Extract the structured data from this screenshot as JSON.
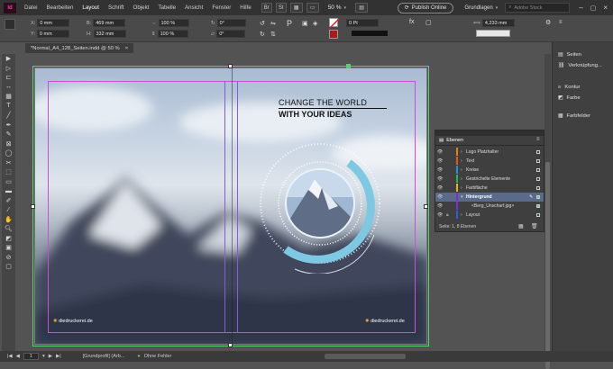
{
  "app": {
    "logo": "Id"
  },
  "menu": [
    "Datei",
    "Bearbeiten",
    "Layout",
    "Schrift",
    "Objekt",
    "Tabelle",
    "Ansicht",
    "Fenster",
    "Hilfe"
  ],
  "menubar": {
    "zoom": "50 %",
    "publish_label": "Publish Online",
    "workspace": "Grundlagen",
    "search_placeholder": "Adobe Stock"
  },
  "control": {
    "x_label": "X:",
    "x": "0 mm",
    "y_label": "Y:",
    "y": "0 mm",
    "b_label": "B:",
    "b": "469 mm",
    "h_label": "H:",
    "h": "332 mm",
    "scale_x": "100 %",
    "scale_y": "100 %",
    "angle": "0°",
    "shear": "0°",
    "stroke_weight": "0 Pt",
    "size_value": "4,233 mm",
    "opacity": "100 %"
  },
  "tab": {
    "title": "*Normal_A4_128_Seiten.indd @ 50 %",
    "close": "×"
  },
  "page": {
    "headline1": "CHANGE THE WORLD",
    "headline2": "WITH YOUR IDEAS",
    "logo_left": "diedruckerei.de",
    "logo_right": "diedruckerei.de"
  },
  "layers": {
    "title": "Ebenen",
    "rows": [
      {
        "name": "Logo Platzhalter",
        "color": "#e67c1f"
      },
      {
        "name": "Text",
        "color": "#e05a1e"
      },
      {
        "name": "Kreise",
        "color": "#2e8bd8"
      },
      {
        "name": "Gestrichelte Elemente",
        "color": "#2fb24a"
      },
      {
        "name": "Farbfläche",
        "color": "#d8b52a"
      },
      {
        "name": "Hintergrund",
        "color": "#7a2fd8"
      },
      {
        "name": "<Berg_Unscharf.jpg>",
        "color": "#7a2fd8"
      },
      {
        "name": "Layout",
        "color": "#2e5ed8"
      }
    ],
    "footer": "Seite: 1, 8 Ebenen"
  },
  "right_panel": {
    "items": [
      {
        "label": "Seiten"
      },
      {
        "label": "Verknüpfung..."
      },
      {
        "label": "Kontur"
      },
      {
        "label": "Farbe"
      },
      {
        "label": "Farbfelder"
      }
    ]
  },
  "status": {
    "page": "1",
    "master": "[Grundprofil] (Arb...",
    "errors": "Ohne Fehler"
  },
  "colors": {
    "accent_frame": "#56d26b",
    "circle": "#7ec8e3",
    "margin_guide": "#d24ad8",
    "column_guide": "#8a5ad8"
  }
}
